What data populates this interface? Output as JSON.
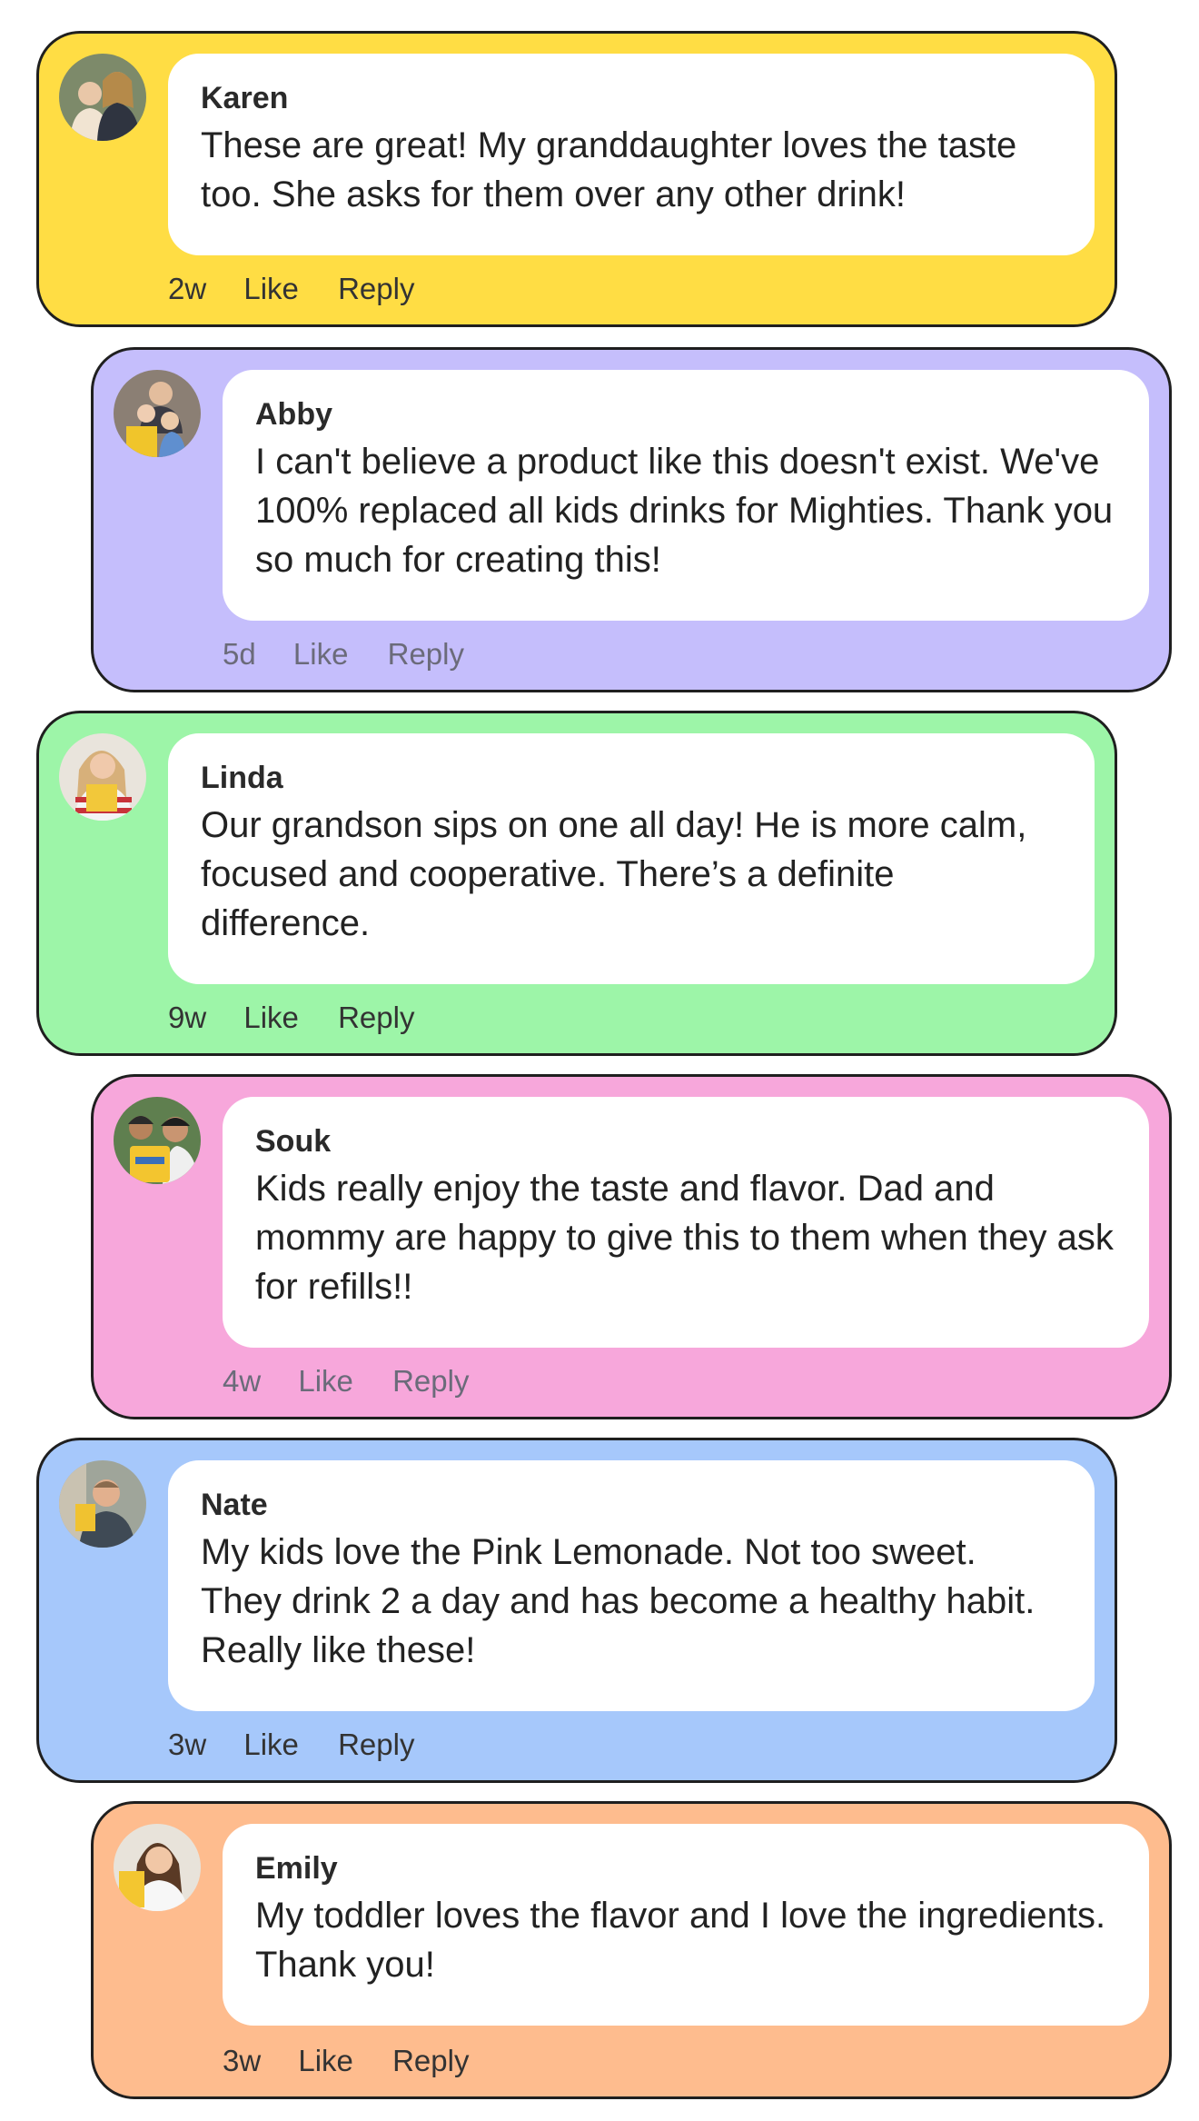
{
  "comments": [
    {
      "name": "Karen",
      "text": "These are great! My granddaughter loves the taste too. She asks for them over any other drink!",
      "time": "2w",
      "like": "Like",
      "reply": "Reply",
      "color": "#FFDD44"
    },
    {
      "name": "Abby",
      "text": "I can't believe a product like this doesn't exist. We've 100% replaced all kids drinks for Mighties. Thank you so much for creating this!",
      "time": "5d",
      "like": "Like",
      "reply": "Reply",
      "color": "#C5BEFC"
    },
    {
      "name": "Linda",
      "text": "Our grandson sips on one all day! He is more calm, focused and cooperative. There’s a definite difference.",
      "time": "9w",
      "like": "Like",
      "reply": "Reply",
      "color": "#9DF5A8"
    },
    {
      "name": "Souk",
      "text": "Kids really enjoy the taste and flavor. Dad and mommy are happy to give this to them when they ask for refills!!",
      "time": "4w",
      "like": "Like",
      "reply": "Reply",
      "color": "#F7A7DB"
    },
    {
      "name": "Nate",
      "text": "My kids love the Pink Lemonade. Not too sweet. They drink 2 a day and has become a healthy habit. Really like these!",
      "time": "3w",
      "like": "Like",
      "reply": "Reply",
      "color": "#A6C8FB"
    },
    {
      "name": "Emily",
      "text": "My toddler loves the flavor and I love the ingredients. Thank you!",
      "time": "3w",
      "like": "Like",
      "reply": "Reply",
      "color": "#FEBC8E"
    }
  ]
}
